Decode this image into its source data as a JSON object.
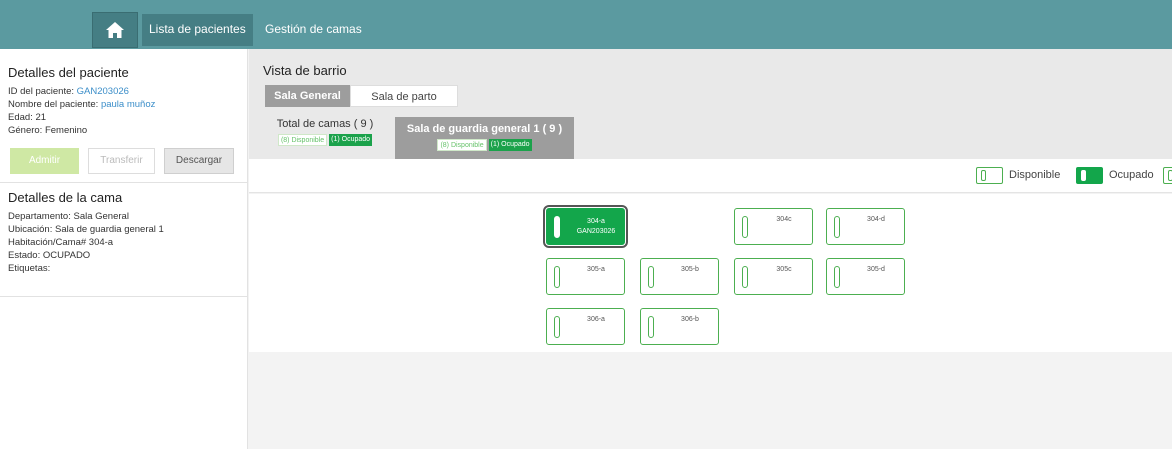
{
  "topbar": {
    "home_icon": "home-icon",
    "nav": [
      {
        "label": "Lista de pacientes",
        "active": true
      },
      {
        "label": "Gestión de camas",
        "active": false
      }
    ]
  },
  "patient": {
    "title": "Detalles del paciente",
    "id_label": "ID del paciente:",
    "id_value": "GAN203026",
    "name_label": "Nombre del paciente:",
    "name_value": "paula muñoz",
    "age_label": "Edad:",
    "age_value": "21",
    "gender_label": "Género:",
    "gender_value": "Femenino"
  },
  "actions": {
    "admit": "Admitir",
    "transfer": "Transferir",
    "download": "Descargar"
  },
  "bed": {
    "title": "Detalles de la cama",
    "department_label": "Departamento:",
    "department_value": "Sala General",
    "location_label": "Ubicación:",
    "location_value": "Sala de guardia general 1",
    "room_label": "Habitación/Cama#",
    "room_value": "304-a",
    "status_label": "Estado:",
    "status_value": "OCUPADO",
    "tags_label": "Etiquetas:"
  },
  "view": {
    "title": "Vista de barrio",
    "tabs": [
      "Sala General",
      "Sala de parto"
    ],
    "active_tab": "Sala General",
    "summary_total": {
      "label": "Total de camas ( 9 )",
      "available": "(8) Disponible",
      "occupied": "(1) Ocupado"
    },
    "summary_ward": {
      "label": "Sala de guardia general 1 ( 9 )",
      "available": "(8) Disponible",
      "occupied": "(1) Ocupado"
    }
  },
  "legend": {
    "available": "Disponible",
    "occupied": "Ocupado"
  },
  "beds": [
    {
      "label": "304-a",
      "patient": "GAN203026",
      "status": "occupied"
    },
    {
      "label": "304c",
      "status": "available"
    },
    {
      "label": "304-d",
      "status": "available"
    },
    {
      "label": "305-a",
      "status": "available"
    },
    {
      "label": "305-b",
      "status": "available"
    },
    {
      "label": "305c",
      "status": "available"
    },
    {
      "label": "305-d",
      "status": "available"
    },
    {
      "label": "306-a",
      "status": "available"
    },
    {
      "label": "306-b",
      "status": "available"
    }
  ],
  "colors": {
    "topbar": "#5b9aa0",
    "topbar_active": "#457e84",
    "occupied": "#13a64b",
    "available_border": "#4caf50",
    "link": "#3b8ec9"
  }
}
